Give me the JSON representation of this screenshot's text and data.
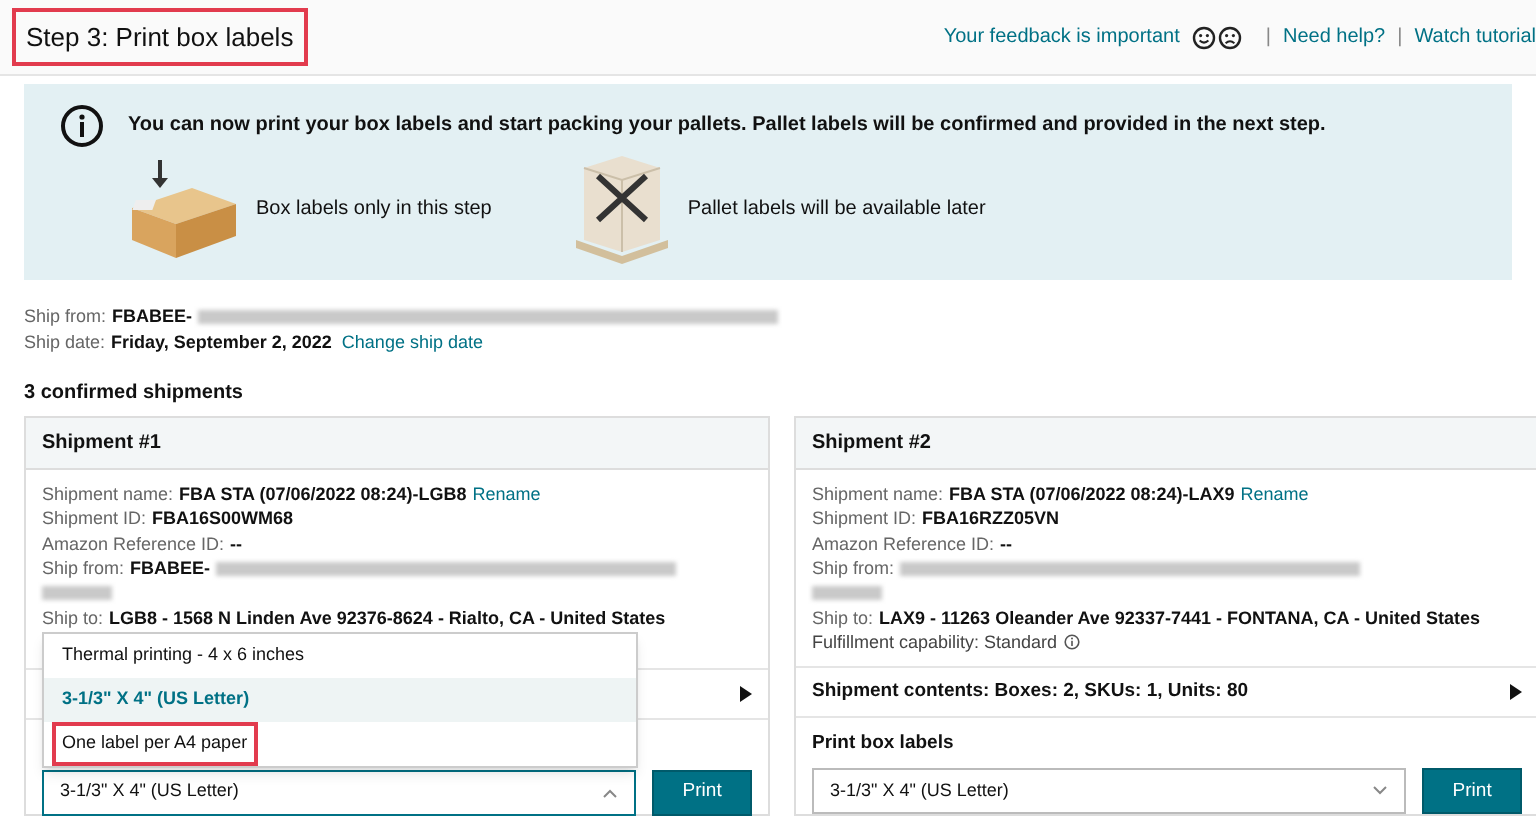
{
  "header": {
    "title": "Step 3: Print box labels",
    "title_highlighted": true,
    "feedback": "Your feedback is important",
    "separator": "|",
    "links": [
      "Need help?",
      "Watch tutorial"
    ]
  },
  "banner": {
    "message": "You can now print your box labels and start packing your pallets. Pallet labels will be confirmed and provided in the next step.",
    "items": [
      {
        "kind": "box",
        "label": "Box labels only in this step"
      },
      {
        "kind": "pallet",
        "label": "Pallet labels will be available later"
      }
    ]
  },
  "ship_from": {
    "label": "Ship from:",
    "value": "FBABEE-"
  },
  "ship_date": {
    "label": "Ship date:",
    "value": "Friday, September 2, 2022",
    "link": "Change ship date"
  },
  "shipments_heading": "3 confirmed shipments",
  "shipments": [
    {
      "title": "Shipment #1",
      "name_label": "Shipment name:",
      "name": "FBA STA (07/06/2022 08:24)-LGB8",
      "rename": "Rename",
      "id_label": "Shipment ID:",
      "id": "FBA16S00WM68",
      "ref_label": "Amazon Reference ID:",
      "ref": "--",
      "from_label": "Ship from:",
      "from": "FBABEE-",
      "to_label": "Ship to:",
      "to": "LGB8 - 1568 N Linden Ave 92376-8624 - Rialto, CA - United States",
      "select_value": "3-1/3\" X 4\" (US Letter)",
      "print": "Print",
      "dropdown_open": true,
      "options": [
        {
          "label": "Thermal printing - 4 x 6 inches",
          "selected": false,
          "highlighted": false
        },
        {
          "label": "3-1/3\" X 4\" (US Letter)",
          "selected": true,
          "highlighted": false
        },
        {
          "label": "One label per A4 paper",
          "selected": false,
          "highlighted": true
        }
      ]
    },
    {
      "title": "Shipment #2",
      "name_label": "Shipment name:",
      "name": "FBA STA (07/06/2022 08:24)-LAX9",
      "rename": "Rename",
      "id_label": "Shipment ID:",
      "id": "FBA16RZZ05VN",
      "ref_label": "Amazon Reference ID:",
      "ref": "--",
      "from_label": "Ship from:",
      "to_label": "Ship to:",
      "to": "LAX9 - 11263 Oleander Ave 92337-7441 - FONTANA, CA - United States",
      "capability": "Fulfillment capability: Standard",
      "contents": "Shipment contents: Boxes: 2, SKUs: 1, Units: 80",
      "print_heading": "Print box labels",
      "select_value": "3-1/3\" X 4\" (US Letter)",
      "print": "Print",
      "dropdown_open": false
    }
  ]
}
